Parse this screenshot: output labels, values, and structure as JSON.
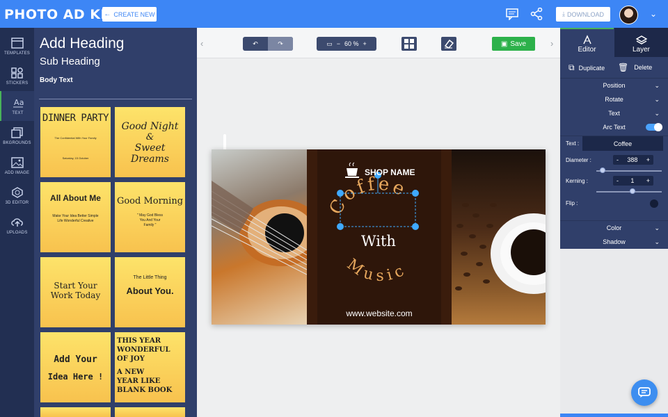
{
  "app": {
    "logo": "PHOTO AD KING"
  },
  "header": {
    "create_label": "CREATE NEW",
    "download_label": "DOWNLOAD"
  },
  "nav": {
    "items": [
      {
        "label": "TEMPLATES",
        "icon": "templates-icon"
      },
      {
        "label": "STICKERS",
        "icon": "stickers-icon"
      },
      {
        "label": "TEXT",
        "icon": "text-icon",
        "active": true
      },
      {
        "label": "BKGROUNDS",
        "icon": "backgrounds-icon"
      },
      {
        "label": "ADD IMAGE",
        "icon": "image-icon"
      },
      {
        "label": "3D EDITOR",
        "icon": "3d-editor-icon"
      },
      {
        "label": "UPLOADS",
        "icon": "upload-icon"
      }
    ]
  },
  "text_panel": {
    "heading": "Add Heading",
    "subheading": "Sub Heading",
    "body": "Body Text",
    "cards": [
      {
        "lines": [
          "DINNER PARTY",
          "The Confidential With Your Family",
          "Saturday, 15 October"
        ]
      },
      {
        "lines": [
          "Good Night",
          "&",
          "Sweet Dreams"
        ]
      },
      {
        "lines": [
          "All About Me",
          "Make Your Idea Better Simple Life Wonderful Creative"
        ]
      },
      {
        "lines": [
          "Good Morning",
          "\" May God Bless You And Your Family \""
        ]
      },
      {
        "lines": [
          "Start Your",
          "Work Today"
        ]
      },
      {
        "lines": [
          "The Little Thing",
          "About You."
        ]
      },
      {
        "lines": [
          "Add Your",
          "Idea Here !"
        ]
      },
      {
        "lines": [
          "THIS YEAR",
          "WONDERFUL",
          "OF JOY",
          "A NEW",
          "YEAR LIKE",
          "BLANK BOOK"
        ]
      }
    ]
  },
  "toolbar": {
    "zoom": "60 %",
    "save_label": "Save"
  },
  "design": {
    "shop_name": "SHOP NAME",
    "arc_text": "Coffee",
    "line2": "With",
    "line3": "Music",
    "website": "www.website.com"
  },
  "right_panel": {
    "tab_editor": "Editor",
    "tab_layer": "Layer",
    "duplicate": "Duplicate",
    "delete": "Delete",
    "position": "Position",
    "rotate": "Rotate",
    "text": "Text",
    "arc_text": "Arc Text",
    "text_label": "Text :",
    "text_value": "Coffee",
    "diameter_label": "Diameter :",
    "diameter_value": "388",
    "kerning_label": "Kerning :",
    "kerning_value": "1",
    "flip_label": "Flip :",
    "color": "Color",
    "shadow": "Shadow",
    "diameter_level": 0.1,
    "kerning_level": 0.55
  },
  "colors": {
    "topbar": "#3d86f5",
    "nav": "#222f52",
    "panel": "#303f6a",
    "save": "#2cb14a",
    "card": "#fcd45c",
    "accent_text": "#e6a75d"
  }
}
